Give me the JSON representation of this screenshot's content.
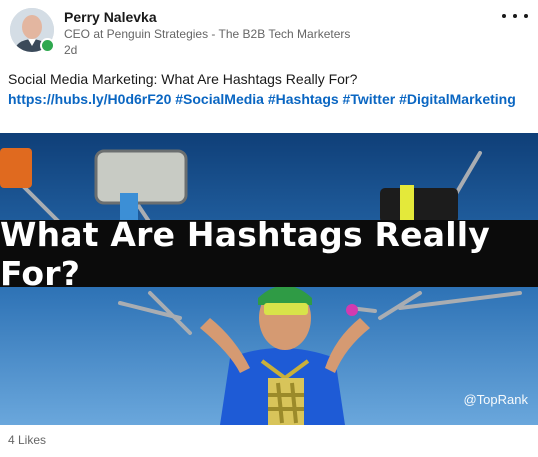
{
  "author": {
    "name": "Perry Nalevka",
    "title": "CEO at Penguin Strategies - The B2B Tech Marketers",
    "age": "2d",
    "presence_color": "#2fa84f"
  },
  "post": {
    "text": "Social Media Marketing: What Are Hashtags Really For?",
    "link": "https://hubs.ly/H0d6rF20",
    "hashtags": [
      "#SocialMedia",
      "#Hashtags",
      "#Twitter",
      "#DigitalMarketing"
    ],
    "link_color": "#0a66c2"
  },
  "image": {
    "title": "What Are Hashtags Really For?",
    "watermark": "@TopRank"
  },
  "footer": {
    "likes": "4 Likes"
  }
}
